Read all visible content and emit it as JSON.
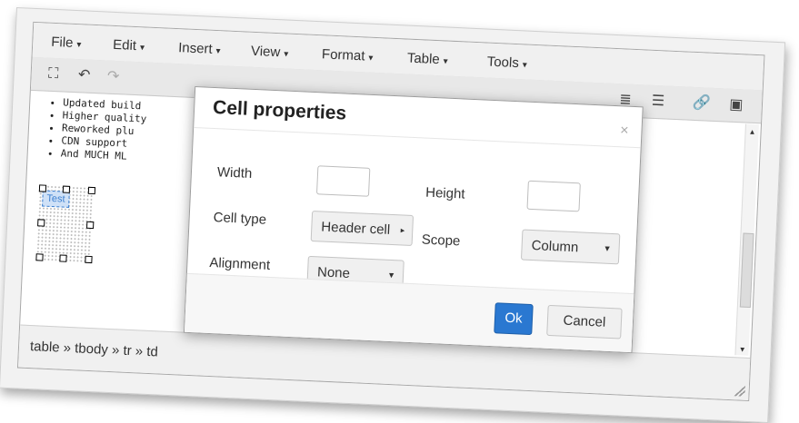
{
  "menubar": {
    "items": [
      {
        "label": "File"
      },
      {
        "label": "Edit"
      },
      {
        "label": "Insert"
      },
      {
        "label": "View"
      },
      {
        "label": "Format"
      },
      {
        "label": "Table"
      },
      {
        "label": "Tools"
      }
    ]
  },
  "toolbar": {
    "icons": [
      "clear-formatting-icon",
      "undo-icon",
      "redo-icon",
      "indent-left-icon",
      "indent-right-icon",
      "link-icon",
      "image-icon"
    ]
  },
  "content": {
    "list": [
      "Updated build",
      "Higher quality",
      "Reworked plu",
      "CDN support",
      "And MUCH ML"
    ],
    "table_cell_text": "Test"
  },
  "statusbar": {
    "path": "table » tbody » tr » td"
  },
  "dialog": {
    "title": "Cell properties",
    "close": "×",
    "width_label": "Width",
    "height_label": "Height",
    "celltype_label": "Cell type",
    "celltype_value": "Header cell",
    "scope_label": "Scope",
    "scope_value": "Column",
    "alignment_label": "Alignment",
    "alignment_value": "None",
    "ok_label": "Ok",
    "cancel_label": "Cancel"
  },
  "colors": {
    "primary_button": "#2a78d1",
    "selection": "#3b7fd0"
  }
}
